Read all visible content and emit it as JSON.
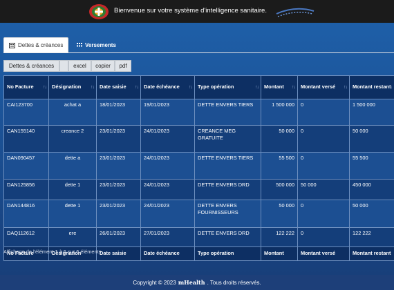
{
  "header": {
    "welcome_text": "Bienvenue sur votre système d'intelligence sanitaire."
  },
  "tabs": [
    {
      "label": "Dettes & créances",
      "icon": "list-icon",
      "active": true
    },
    {
      "label": "Versements",
      "icon": "grid-icon",
      "active": false
    }
  ],
  "toolbar": {
    "title": "Dettes & créances",
    "excel": "excel",
    "copier": "copier",
    "pdf": "pdf"
  },
  "table": {
    "columns": [
      "No Facture",
      "Désignation",
      "Date saisie",
      "Date échéance",
      "Type opération",
      "Montant",
      "Montant versé",
      "Montant restant"
    ],
    "rows": [
      {
        "no": "CAI123700",
        "designation": "achat a",
        "saisie": "18/01/2023",
        "echeance": "19/01/2023",
        "type": "DETTE ENVERS TIERS",
        "montant": "1 500 000",
        "verse": "0",
        "restant": "1 500 000"
      },
      {
        "no": "CAN155140",
        "designation": "creance 2",
        "saisie": "23/01/2023",
        "echeance": "24/01/2023",
        "type": "CREANCE MEG GRATUITE",
        "montant": "50 000",
        "verse": "0",
        "restant": "50 000"
      },
      {
        "no": "DAN090457",
        "designation": "dette a",
        "saisie": "23/01/2023",
        "echeance": "24/01/2023",
        "type": "DETTE ENVERS TIERS",
        "montant": "55 500",
        "verse": "0",
        "restant": "55 500"
      },
      {
        "no": "DAN125856",
        "designation": "dette 1",
        "saisie": "23/01/2023",
        "echeance": "24/01/2023",
        "type": "DETTE ENVERS DRD",
        "montant": "500 000",
        "verse": "50 000",
        "restant": "450 000"
      },
      {
        "no": "DAN144816",
        "designation": "dette 1",
        "saisie": "23/01/2023",
        "echeance": "24/01/2023",
        "type": "DETTE ENVERS FOURNISSEURS",
        "montant": "50 000",
        "verse": "0",
        "restant": "50 000"
      },
      {
        "no": "DAQ112612",
        "designation": "ere",
        "saisie": "26/01/2023",
        "echeance": "27/01/2023",
        "type": "DETTE ENVERS DRD",
        "montant": "122 222",
        "verse": "0",
        "restant": "122 222"
      }
    ]
  },
  "info_text": "Affichage de l'élément 1 à 6 sur 6 éléments",
  "footer": {
    "prefix": "Copyright © 2023",
    "brand": "mHealth",
    "suffix": ". Tous droits réservés."
  }
}
